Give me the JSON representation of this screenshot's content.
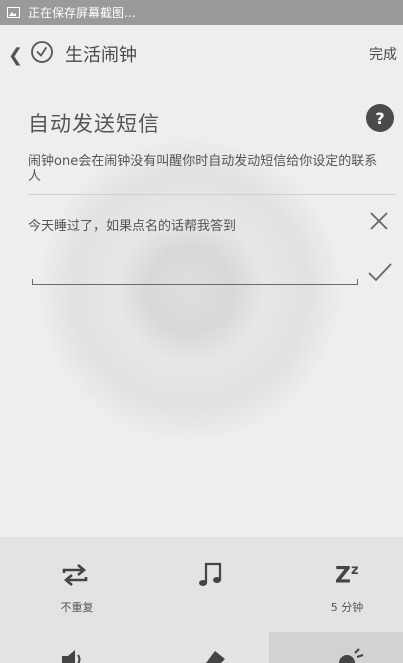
{
  "status_bar": {
    "text": "正在保存屏幕截图..."
  },
  "header": {
    "title": "生活闹钟",
    "done_label": "完成"
  },
  "section": {
    "title": "自动发送短信",
    "help_label": "?",
    "description": "闹钟one会在闹钟没有叫醒你时自动发动短信给你设定的联系人"
  },
  "message": {
    "text": "今天睡过了，如果点名的话帮我答到"
  },
  "toolbar": {
    "repeat_label": "不重复",
    "snooze_label": "5 分钟",
    "snooze_symbol": "Z",
    "snooze_sup": "z"
  },
  "icons": {
    "back": "chevron-left-icon",
    "clock": "clock-icon",
    "help": "question-icon",
    "clear": "close-icon",
    "confirm": "check-icon",
    "repeat": "repeat-icon",
    "music": "music-note-icon",
    "snooze": "snooze-icon",
    "volume": "volume-icon",
    "tag": "tag-icon",
    "light": "light-icon"
  },
  "colors": {
    "accent": "#4b4b4b",
    "background": "#eceef0",
    "status_bar": "#9a9a9a"
  }
}
